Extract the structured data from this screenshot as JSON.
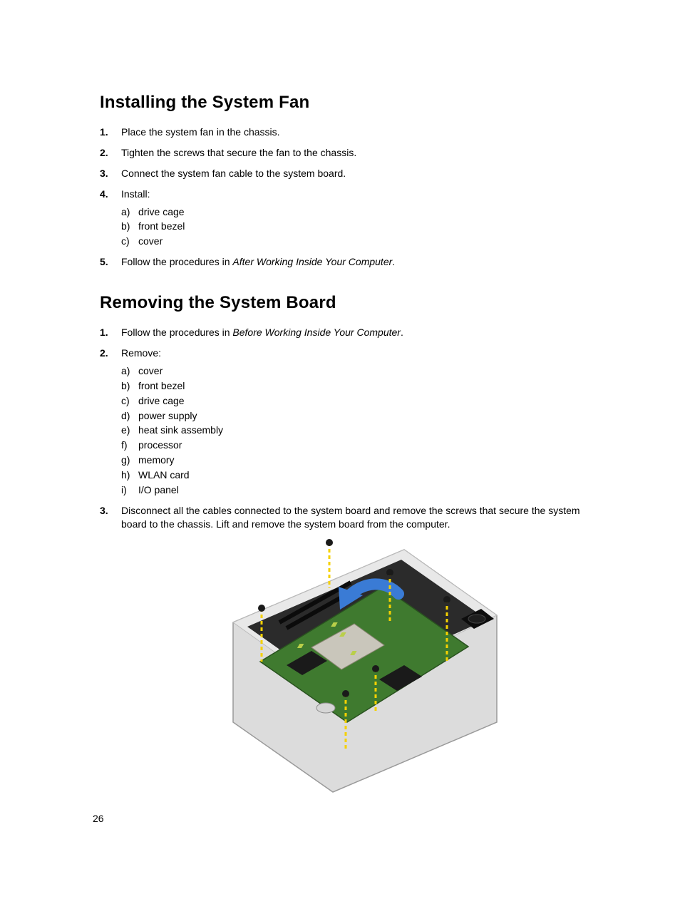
{
  "pageNumber": "26",
  "sections": [
    {
      "title": "Installing the System Fan",
      "steps": [
        {
          "text": "Place the system fan in the chassis."
        },
        {
          "text": "Tighten the screws that secure the fan to the chassis."
        },
        {
          "text": "Connect the system fan cable to the system board."
        },
        {
          "text": "Install:",
          "sub": [
            "drive cage",
            "front bezel",
            "cover"
          ]
        },
        {
          "text_pre": "Follow the procedures in ",
          "text_em": "After Working Inside Your Computer",
          "text_post": "."
        }
      ]
    },
    {
      "title": "Removing the System Board",
      "steps": [
        {
          "text_pre": "Follow the procedures in ",
          "text_em": "Before Working Inside Your Computer",
          "text_post": "."
        },
        {
          "text": "Remove:",
          "sub": [
            "cover",
            "front bezel",
            "drive cage",
            "power supply",
            "heat sink assembly",
            "processor",
            "memory",
            "WLAN card",
            "I/O panel"
          ]
        },
        {
          "text": "Disconnect all the cables connected to the system board and remove the screws that secure the system board to the chassis. Lift and remove the system board from the computer."
        }
      ]
    }
  ]
}
